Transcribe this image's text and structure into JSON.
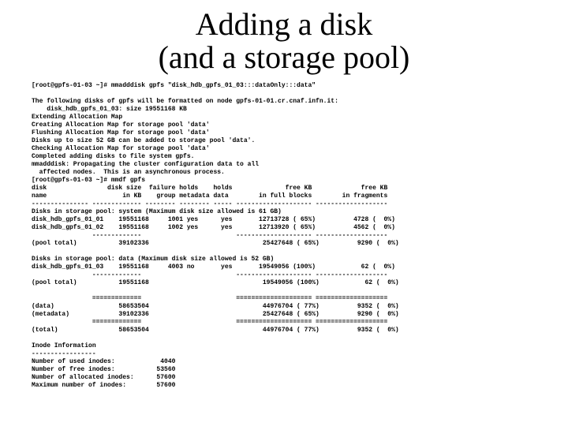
{
  "title_line1": "Adding a disk",
  "title_line2": "(and a storage pool)",
  "term": {
    "cmd1": "[root@gpfs-01-03 ~]# mmadddisk gpfs \"disk_hdb_gpfs_01_03:::dataOnly:::data\"",
    "blank": "",
    "l01": "The following disks of gpfs will be formatted on node gpfs-01-01.cr.cnaf.infn.it:",
    "l02": "    disk_hdb_gpfs_01_03: size 19551168 KB",
    "l03": "Extending Allocation Map",
    "l04": "Creating Allocation Map for storage pool 'data'",
    "l05": "Flushing Allocation Map for storage pool 'data'",
    "l06": "Disks up to size 52 GB can be added to storage pool 'data'.",
    "l07": "Checking Allocation Map for storage pool 'data'",
    "l08": "Completed adding disks to file system gpfs.",
    "l09": "mmadddisk: Propagating the cluster configuration data to all",
    "l10": "  affected nodes.  This is an asynchronous process.",
    "cmd2": "[root@gpfs-01-03 ~]# mmdf gpfs",
    "h1": "disk                disk size  failure holds    holds              free KB             free KB",
    "h2": "name                    in KB    group metadata data        in full blocks        in fragments",
    "h3": "--------------- ------------- -------- -------- ----- -------------------- -------------------",
    "p1a": "Disks in storage pool: system (Maximum disk size allowed is 61 GB)",
    "p1b": "disk_hdb_gpfs_01_01    19551168     1001 yes      yes       12713728 ( 65%)          4728 (  0%)",
    "p1c": "disk_hdb_gpfs_01_02    19551168     1002 yes      yes       12713920 ( 65%)          4562 (  0%)",
    "sep1": "                -------------                         -------------------- -------------------",
    "p1t": "(pool total)           39102336                              25427648 ( 65%)          9290 (  0%)",
    "p2a": "Disks in storage pool: data (Maximum disk size allowed is 52 GB)",
    "p2b": "disk_hdb_gpfs_01_03    19551168     4003 no       yes       19549056 (100%)            62 (  0%)",
    "sep2": "                -------------                         -------------------- -------------------",
    "p2t": "(pool total)           19551168                              19549056 (100%)            62 (  0%)",
    "sep3": "                =============                         ==================== ===================",
    "t1": "(data)                 58653504                              44976704 ( 77%)          9352 (  0%)",
    "t2": "(metadata)             39102336                              25427648 ( 65%)          9290 (  0%)",
    "sep4": "                =============                         ==================== ===================",
    "tt": "(total)                58653504                              44976704 ( 77%)          9352 (  0%)",
    "ii0": "Inode Information",
    "ii1": "-----------------",
    "ii2": "Number of used inodes:            4040",
    "ii3": "Number of free inodes:           53560",
    "ii4": "Number of allocated inodes:      57600",
    "ii5": "Maximum number of inodes:        57600"
  }
}
